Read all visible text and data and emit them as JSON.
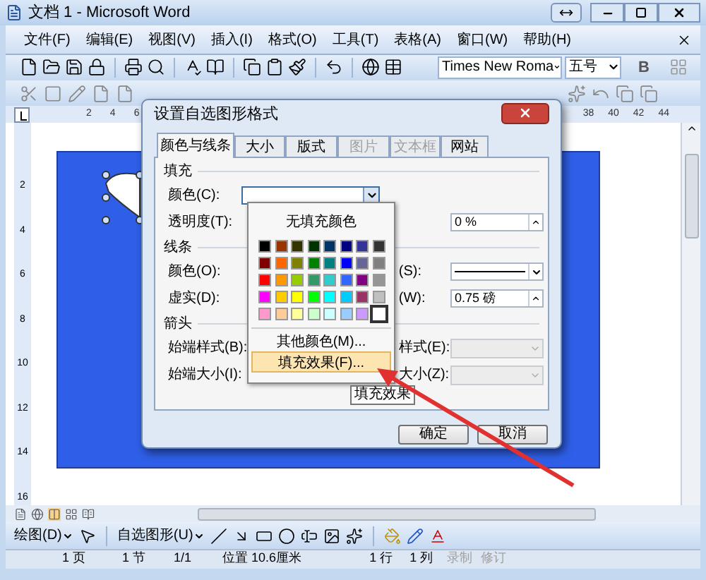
{
  "window": {
    "title": "文档 1 - Microsoft Word"
  },
  "menu": [
    {
      "label": "文件(F)"
    },
    {
      "label": "编辑(E)"
    },
    {
      "label": "视图(V)"
    },
    {
      "label": "插入(I)"
    },
    {
      "label": "格式(O)"
    },
    {
      "label": "工具(T)"
    },
    {
      "label": "表格(A)"
    },
    {
      "label": "窗口(W)"
    },
    {
      "label": "帮助(H)"
    }
  ],
  "toolbar": {
    "font": "Times New Roma",
    "size": "五号",
    "bold": "B"
  },
  "ruler": {
    "left_ticks": [
      "2",
      "4",
      "6"
    ],
    "right_ticks": [
      "38",
      "40",
      "42",
      "44"
    ],
    "vertical_ticks": [
      "2",
      "4",
      "6",
      "8",
      "10",
      "12",
      "14",
      "16"
    ]
  },
  "dialog": {
    "title": "设置自选图形格式",
    "tabs": [
      {
        "label": "颜色与线条",
        "selected": true,
        "disabled": false
      },
      {
        "label": "大小",
        "selected": false,
        "disabled": false
      },
      {
        "label": "版式",
        "selected": false,
        "disabled": false
      },
      {
        "label": "图片",
        "selected": false,
        "disabled": true
      },
      {
        "label": "文本框",
        "selected": false,
        "disabled": true
      },
      {
        "label": "网站",
        "selected": false,
        "disabled": false
      }
    ],
    "sections": [
      {
        "title": "填充",
        "rows": [
          {
            "label": "颜色(C):",
            "kind": "color"
          },
          {
            "label": "透明度(T):",
            "kind": "spin",
            "value": "0 %"
          }
        ]
      },
      {
        "title": "线条",
        "rows": [
          {
            "label": "颜色(O):",
            "right_label": "(S):",
            "kind": "line"
          },
          {
            "label": "虚实(D):",
            "right_label": "(W):",
            "kind": "spin",
            "value": "0.75 磅"
          }
        ]
      },
      {
        "title": "箭头",
        "rows": [
          {
            "label": "始端样式(B):",
            "right_label": "样式(E):",
            "kind": "combo"
          },
          {
            "label": "始端大小(I):",
            "right_label": "大小(Z):",
            "kind": "combo"
          }
        ]
      }
    ],
    "buttons": [
      "确定",
      "取消"
    ]
  },
  "color_menu": {
    "none": "无填充颜色",
    "swatches": [
      {
        "color": "#000000",
        "selected": false
      },
      {
        "color": "#993300",
        "selected": false
      },
      {
        "color": "#333300",
        "selected": false
      },
      {
        "color": "#003300",
        "selected": false
      },
      {
        "color": "#003366",
        "selected": false
      },
      {
        "color": "#000080",
        "selected": false
      },
      {
        "color": "#333399",
        "selected": false
      },
      {
        "color": "#333333",
        "selected": false
      },
      {
        "color": "#800000",
        "selected": false
      },
      {
        "color": "#ff6600",
        "selected": false
      },
      {
        "color": "#808000",
        "selected": false
      },
      {
        "color": "#008000",
        "selected": false
      },
      {
        "color": "#008080",
        "selected": false
      },
      {
        "color": "#0000ff",
        "selected": false
      },
      {
        "color": "#666699",
        "selected": false
      },
      {
        "color": "#808080",
        "selected": false
      },
      {
        "color": "#ff0000",
        "selected": false
      },
      {
        "color": "#ff9900",
        "selected": false
      },
      {
        "color": "#99cc00",
        "selected": false
      },
      {
        "color": "#339966",
        "selected": false
      },
      {
        "color": "#33cccc",
        "selected": false
      },
      {
        "color": "#3366ff",
        "selected": false
      },
      {
        "color": "#800080",
        "selected": false
      },
      {
        "color": "#969696",
        "selected": false
      },
      {
        "color": "#ff00ff",
        "selected": false
      },
      {
        "color": "#ffcc00",
        "selected": false
      },
      {
        "color": "#ffff00",
        "selected": false
      },
      {
        "color": "#00ff00",
        "selected": false
      },
      {
        "color": "#00ffff",
        "selected": false
      },
      {
        "color": "#00ccff",
        "selected": false
      },
      {
        "color": "#993366",
        "selected": false
      },
      {
        "color": "#c0c0c0",
        "selected": false
      },
      {
        "color": "#ff99cc",
        "selected": false
      },
      {
        "color": "#ffcc99",
        "selected": false
      },
      {
        "color": "#ffff99",
        "selected": false
      },
      {
        "color": "#ccffcc",
        "selected": false
      },
      {
        "color": "#ccffff",
        "selected": false
      },
      {
        "color": "#99ccff",
        "selected": false
      },
      {
        "color": "#cc99ff",
        "selected": false
      },
      {
        "color": "#ffffff",
        "selected": true
      }
    ],
    "items": [
      {
        "label": "其他颜色(M)...",
        "selected": false
      },
      {
        "label": "填充效果(F)...",
        "selected": true
      }
    ],
    "tooltip": "填充效果"
  },
  "drawing_toolbar": {
    "draw": "绘图(D)",
    "autoshapes": "自选图形(U)"
  },
  "status_bar": [
    {
      "text": "1 页",
      "disabled": false
    },
    {
      "text": "1 节",
      "disabled": false
    },
    {
      "text": "1/1",
      "disabled": false
    },
    {
      "text": "位置 10.6厘米",
      "disabled": false
    },
    {
      "text": "1 行",
      "disabled": false
    },
    {
      "text": "1 列",
      "disabled": false
    },
    {
      "text": "录制",
      "disabled": true
    },
    {
      "text": "修订",
      "disabled": true
    }
  ]
}
